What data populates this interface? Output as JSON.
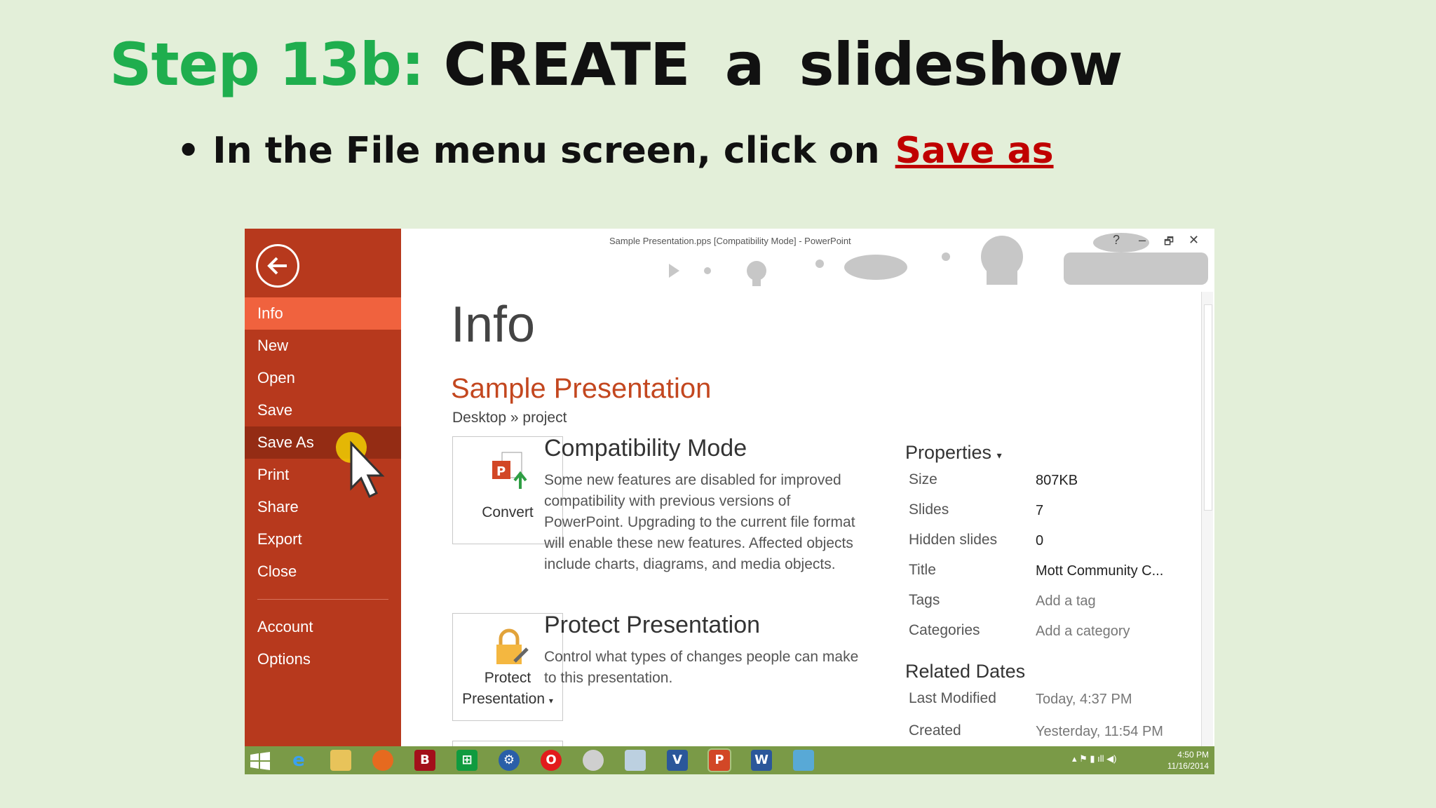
{
  "slide": {
    "step": "Step 13b:",
    "title": "CREATE  a  slideshow",
    "bullet_prefix": "In the File menu screen, click on",
    "bullet_link": "Save as"
  },
  "window": {
    "title": "Sample Presentation.pps [Compatibility Mode] - PowerPoint",
    "help": "?",
    "minimize": "–",
    "restore": "🗗",
    "close": "✕"
  },
  "sidebar": {
    "items": [
      "Info",
      "New",
      "Open",
      "Save",
      "Save As",
      "Print",
      "Share",
      "Export",
      "Close"
    ],
    "bottom_items": [
      "Account",
      "Options"
    ],
    "active": "Info",
    "hover": "Save As"
  },
  "info": {
    "heading": "Info",
    "presentation_name": "Sample Presentation",
    "path": "Desktop » project",
    "compat_button": "Convert",
    "compat_title": "Compatibility Mode",
    "compat_desc": "Some new features are disabled for improved compatibility with previous versions of PowerPoint. Upgrading to the current file format will enable these new features. Affected objects include charts, diagrams, and media objects.",
    "protect_button_line1": "Protect",
    "protect_button_line2": "Presentation",
    "protect_title": "Protect Presentation",
    "protect_desc": "Control what types of changes people can make to this presentation."
  },
  "properties": {
    "heading": "Properties",
    "rows": [
      {
        "label": "Size",
        "value": "807KB"
      },
      {
        "label": "Slides",
        "value": "7"
      },
      {
        "label": "Hidden slides",
        "value": "0"
      },
      {
        "label": "Title",
        "value": "Mott Community C..."
      },
      {
        "label": "Tags",
        "value": "Add a tag"
      },
      {
        "label": "Categories",
        "value": "Add a category"
      }
    ],
    "related_heading": "Related Dates",
    "dates": [
      {
        "label": "Last Modified",
        "value": "Today, 4:37 PM"
      },
      {
        "label": "Created",
        "value": "Yesterday, 11:54 PM"
      }
    ]
  },
  "taskbar": {
    "time": "4:50 PM",
    "date": "11/16/2014"
  },
  "colors": {
    "sidebar": "#b7391d",
    "active_item": "#f0623e",
    "accent_title": "#c3471f",
    "taskbar": "#7a9a47"
  }
}
